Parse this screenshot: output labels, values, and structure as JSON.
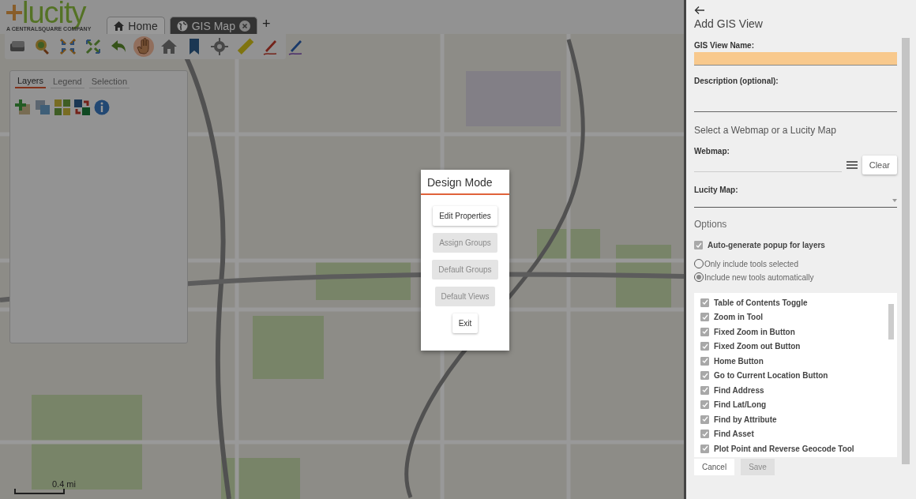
{
  "header": {
    "logo": "lucity",
    "logo_tagline": "A CENTRALSQUARE COMPANY",
    "tabs": [
      {
        "label": "Home",
        "selected": false,
        "closable": false
      },
      {
        "label": "GIS Map",
        "selected": true,
        "closable": true
      }
    ],
    "add_tab": "+"
  },
  "toolbar": {
    "tools": [
      {
        "kind": "basemap",
        "selected": false
      },
      {
        "kind": "zoom",
        "selected": false
      },
      {
        "kind": "zoom-in",
        "selected": false
      },
      {
        "kind": "zoom-out",
        "selected": false
      },
      {
        "kind": "back",
        "selected": false
      },
      {
        "kind": "pan",
        "selected": true
      },
      {
        "kind": "home",
        "selected": false
      },
      {
        "kind": "bookmark",
        "selected": false
      },
      {
        "kind": "locate",
        "selected": false
      },
      {
        "kind": "measure",
        "selected": false
      },
      {
        "kind": "sketch",
        "selected": false
      },
      {
        "kind": "markup",
        "selected": false
      }
    ]
  },
  "layers_panel": {
    "tabs": [
      {
        "label": "Layers",
        "selected": true
      },
      {
        "label": "Legend",
        "selected": false
      },
      {
        "label": "Selection",
        "selected": false
      }
    ]
  },
  "scale": {
    "label": "0.4 mi"
  },
  "dialog": {
    "title": "Design Mode",
    "buttons": [
      {
        "label": "Edit Properties",
        "disabled": false
      },
      {
        "label": "Assign Groups",
        "disabled": true
      },
      {
        "label": "Default Groups",
        "disabled": true
      },
      {
        "label": "Default Views",
        "disabled": true
      },
      {
        "label": "Exit",
        "disabled": false
      }
    ]
  },
  "side_panel": {
    "title": "Add GIS View",
    "name_field": {
      "label": "GIS View Name:",
      "highlighted": true
    },
    "description_field": {
      "label": "Description (optional):"
    },
    "section": "Select a Webmap or a Lucity Map",
    "webmap_field": {
      "label": "Webmap:",
      "clear": "Clear"
    },
    "lucity_map_field": {
      "label": "Lucity Map:"
    },
    "options_title": "Options",
    "auto_popup": {
      "label": "Auto-generate popup for layers",
      "checked": true
    },
    "radios": [
      {
        "label": "Only include tools selected",
        "selected": false
      },
      {
        "label": "Include new tools automatically",
        "selected": true
      }
    ],
    "tools": [
      {
        "label": "Table of Contents Toggle",
        "checked": true
      },
      {
        "label": "Zoom in Tool",
        "checked": true
      },
      {
        "label": "Fixed Zoom in Button",
        "checked": true
      },
      {
        "label": "Fixed Zoom out Button",
        "checked": true
      },
      {
        "label": "Home Button",
        "checked": true
      },
      {
        "label": "Go to Current Location Button",
        "checked": true
      },
      {
        "label": "Find Address",
        "checked": true
      },
      {
        "label": "Find Lat/Long",
        "checked": true
      },
      {
        "label": "Find by Attribute",
        "checked": true
      },
      {
        "label": "Find Asset",
        "checked": true
      },
      {
        "label": "Plot Point and Reverse Geocode Tool",
        "checked": true
      }
    ],
    "buttons": [
      {
        "label": "Cancel",
        "disabled": false
      },
      {
        "label": "Save",
        "disabled": true
      }
    ]
  }
}
